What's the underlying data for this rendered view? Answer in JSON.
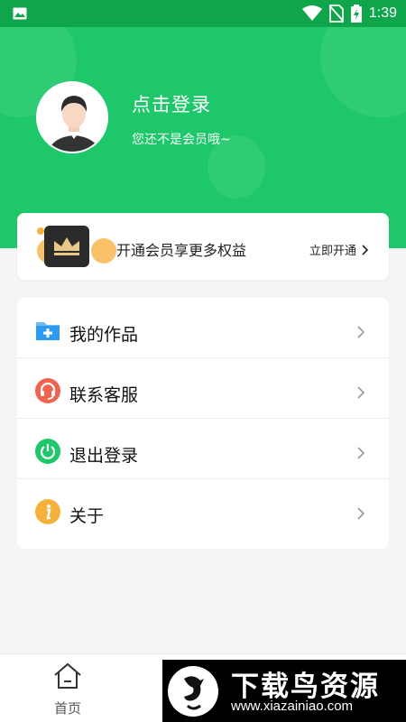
{
  "status_bar": {
    "time": "1:39"
  },
  "profile": {
    "login_title": "点击登录",
    "login_subtitle": "您还不是会员哦~"
  },
  "vip": {
    "text": "开通会员享更多权益",
    "open_label": "立即开通"
  },
  "menu": {
    "items": [
      {
        "label": "我的作品",
        "icon": "folder-plus-icon",
        "color": "#2f9bf0"
      },
      {
        "label": "联系客服",
        "icon": "headset-icon",
        "color": "#f0644f"
      },
      {
        "label": "退出登录",
        "icon": "power-icon",
        "color": "#1ec76a"
      },
      {
        "label": "关于",
        "icon": "info-icon",
        "color": "#f6b13a"
      }
    ]
  },
  "tabbar": {
    "home_label": "首页"
  },
  "watermark": {
    "title": "下载鸟资源",
    "url": "www.xiazainiao.com"
  },
  "colors": {
    "brand_green": "#1ec76a",
    "status_green": "#0fa54b",
    "background": "#f5f5f5"
  }
}
